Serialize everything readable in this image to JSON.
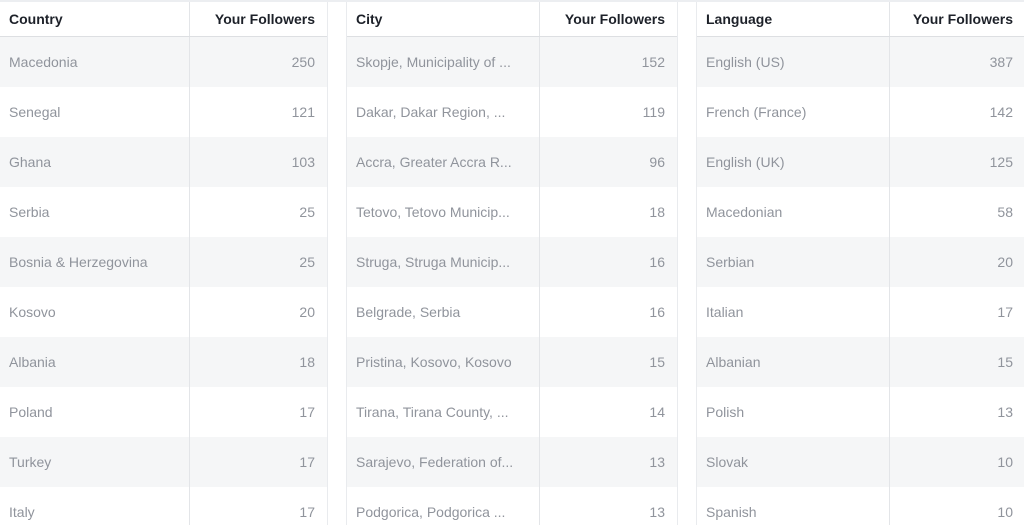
{
  "tables": {
    "country": {
      "headers": [
        "Country",
        "Your Followers"
      ],
      "rows": [
        {
          "name": "Macedonia",
          "value": "250"
        },
        {
          "name": "Senegal",
          "value": "121"
        },
        {
          "name": "Ghana",
          "value": "103"
        },
        {
          "name": "Serbia",
          "value": "25"
        },
        {
          "name": "Bosnia & Herzegovina",
          "value": "25"
        },
        {
          "name": "Kosovo",
          "value": "20"
        },
        {
          "name": "Albania",
          "value": "18"
        },
        {
          "name": "Poland",
          "value": "17"
        },
        {
          "name": "Turkey",
          "value": "17"
        },
        {
          "name": "Italy",
          "value": "17"
        }
      ]
    },
    "city": {
      "headers": [
        "City",
        "Your Followers"
      ],
      "rows": [
        {
          "name": "Skopje, Municipality of ...",
          "value": "152"
        },
        {
          "name": "Dakar, Dakar Region, ...",
          "value": "119"
        },
        {
          "name": "Accra, Greater Accra R...",
          "value": "96"
        },
        {
          "name": "Tetovo, Tetovo Municip...",
          "value": "18"
        },
        {
          "name": "Struga, Struga Municip...",
          "value": "16"
        },
        {
          "name": "Belgrade, Serbia",
          "value": "16"
        },
        {
          "name": "Pristina, Kosovo, Kosovo",
          "value": "15"
        },
        {
          "name": "Tirana, Tirana County, ...",
          "value": "14"
        },
        {
          "name": "Sarajevo, Federation of...",
          "value": "13"
        },
        {
          "name": "Podgorica, Podgorica ...",
          "value": "13"
        }
      ]
    },
    "language": {
      "headers": [
        "Language",
        "Your Followers"
      ],
      "rows": [
        {
          "name": "English (US)",
          "value": "387"
        },
        {
          "name": "French (France)",
          "value": "142"
        },
        {
          "name": "English (UK)",
          "value": "125"
        },
        {
          "name": "Macedonian",
          "value": "58"
        },
        {
          "name": "Serbian",
          "value": "20"
        },
        {
          "name": "Italian",
          "value": "17"
        },
        {
          "name": "Albanian",
          "value": "15"
        },
        {
          "name": "Polish",
          "value": "13"
        },
        {
          "name": "Slovak",
          "value": "10"
        },
        {
          "name": "Spanish",
          "value": "10"
        }
      ]
    }
  }
}
